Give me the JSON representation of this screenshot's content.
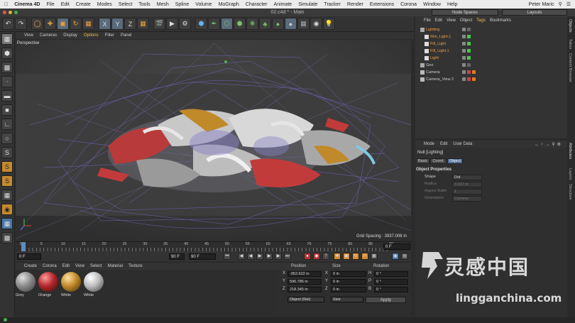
{
  "macbar": {
    "app_name": "Cinema 4D",
    "menus": [
      "File",
      "Edit",
      "Create",
      "Modes",
      "Select",
      "Tools",
      "Mesh",
      "Spline",
      "Volume",
      "MoGraph",
      "Character",
      "Animate",
      "Simulate",
      "Tracker",
      "Render",
      "Extensions",
      "Corona",
      "Window",
      "Help"
    ],
    "user": "Peter Maric"
  },
  "window": {
    "title": "02.c4d * - Main",
    "node_spaces": "Node Spaces",
    "layouts": "Layouts"
  },
  "toolbar": {
    "icons": [
      "undo-icon",
      "redo-icon",
      "live-select-icon",
      "move-icon",
      "scale-icon",
      "rotate-icon",
      "recent-tools-icon",
      "x-axis-icon",
      "y-axis-icon",
      "z-axis-icon",
      "coord-system-icon",
      "render-view-icon",
      "render-picture-viewer-icon",
      "edit-render-settings-icon",
      "cube-icon",
      "pen-icon",
      "subdivision-icon",
      "extrude-icon",
      "cloner-icon",
      "deformer-icon",
      "environment-icon",
      "camera-icon",
      "light-icon"
    ],
    "axis_labels": [
      "X",
      "Y",
      "Z"
    ]
  },
  "viewport": {
    "menus": [
      "View",
      "Cameras",
      "Display",
      "Options",
      "Filter",
      "Panel"
    ],
    "active_menu": "Options",
    "label": "Perspective",
    "grid_spacing": "Grid Spacing : 3937.008 in"
  },
  "timeline": {
    "ticks": [
      "0",
      "5",
      "10",
      "15",
      "20",
      "25",
      "30",
      "35",
      "40",
      "45",
      "50",
      "55",
      "60",
      "65",
      "70",
      "75",
      "80",
      "85",
      "90"
    ],
    "current_frame": "0 F",
    "start_field": "0 F",
    "end_field": "90 F",
    "min_field": "0 F",
    "max_field": "90 F"
  },
  "materials": {
    "menus": [
      "Create",
      "Corona",
      "Edit",
      "View",
      "Select",
      "Material",
      "Texture"
    ],
    "items": [
      {
        "label": "Grey",
        "color": "#8a8a8a"
      },
      {
        "label": "Orange",
        "color": "#b3262c"
      },
      {
        "label": "White",
        "color": "#c08a2a"
      },
      {
        "label": "White",
        "color": "#bcbcbc"
      }
    ]
  },
  "coordinates": {
    "headers": [
      "Position",
      "Size",
      "Rotation"
    ],
    "rows": [
      {
        "axis": "X",
        "pos": "-952.622 in",
        "size_axis": "X",
        "size": "0 in",
        "rot_axis": "H",
        "rot": "0 °"
      },
      {
        "axis": "Y",
        "pos": "596.786 in",
        "size_axis": "Y",
        "size": "0 in",
        "rot_axis": "P",
        "rot": "0 °"
      },
      {
        "axis": "Z",
        "pos": "218.345 in",
        "size_axis": "Z",
        "size": "0 in",
        "rot_axis": "B",
        "rot": "0 °"
      }
    ],
    "mode": "Object (Rel)",
    "size_mode": "Size",
    "apply": "Apply"
  },
  "objects": {
    "menus": [
      "File",
      "Edit",
      "View",
      "Object",
      "Tags",
      "Bookmarks"
    ],
    "active_menu": "Tags",
    "items": [
      {
        "name": "Lighting",
        "selected": true,
        "level": 0
      },
      {
        "name": "Rim_Light.1",
        "selected": true,
        "level": 1
      },
      {
        "name": "Fill_Light",
        "selected": true,
        "level": 1
      },
      {
        "name": "Fill_Light.1",
        "selected": true,
        "level": 1
      },
      {
        "name": "Light",
        "selected": true,
        "level": 1
      },
      {
        "name": "Geo",
        "selected": false,
        "level": 0
      },
      {
        "name": "Camera",
        "selected": false,
        "level": 0
      },
      {
        "name": "Camera_View 2",
        "selected": false,
        "level": 0
      }
    ]
  },
  "attributes": {
    "menus": [
      "Mode",
      "Edit",
      "User Data"
    ],
    "title": "Null [Lighting]",
    "tabs": [
      "Basic",
      "Coord.",
      "Object"
    ],
    "active_tab": "Object",
    "section": "Object Properties",
    "props": [
      {
        "label": "Shape",
        "value": "Dot",
        "enabled": true
      },
      {
        "label": "Radius",
        "value": "3.937 in",
        "enabled": false
      },
      {
        "label": "Aspect Ratio",
        "value": "1",
        "enabled": false
      },
      {
        "label": "Orientation",
        "value": "Camera",
        "enabled": false
      }
    ]
  },
  "side_tabs": [
    "Objects",
    "Takes",
    "Content Browser",
    "Attributes",
    "Layers",
    "Structure"
  ],
  "watermark": {
    "cn": "灵感中国",
    "url": "lingganchina.com"
  }
}
